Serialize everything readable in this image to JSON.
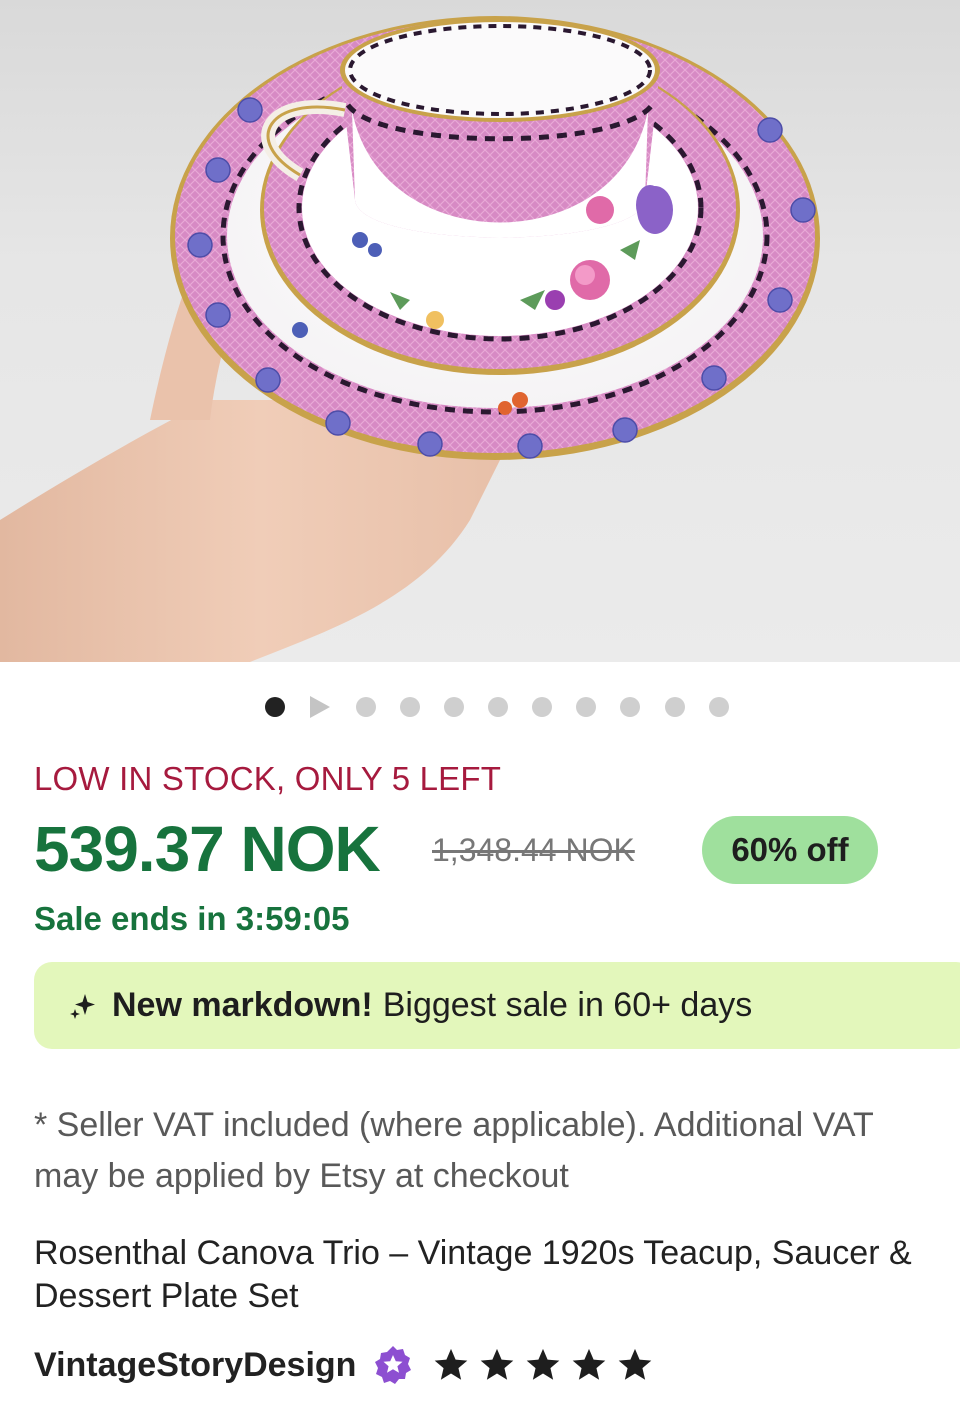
{
  "image": {
    "alt": "Hand holding floral teacup, saucer and plate",
    "carousel": {
      "total_dots": 10,
      "active_index": 0,
      "has_video_indicator": true
    }
  },
  "stock_notice": "LOW IN STOCK, ONLY 5 LEFT",
  "price": {
    "current": "539.37 NOK",
    "original": "1,348.44 NOK",
    "discount_badge": "60% off",
    "sale_ends": "Sale ends in 3:59:05"
  },
  "markdown_banner": {
    "icon": "sparkle-icon",
    "bold_text": "New markdown!",
    "text": "Biggest sale in 60+ days"
  },
  "vat_note": "* Seller VAT included (where applicable). Additional VAT may be applied by Etsy at checkout",
  "listing_title": "Rosenthal Canova Trio – Vintage 1920s Teacup, Saucer & Dessert Plate Set",
  "shop": {
    "name": "VintageStoryDesign",
    "star_seller_icon": "star-seller-badge-icon",
    "rating": 5,
    "rating_max": 5
  },
  "colors": {
    "price_green": "#17733d",
    "stock_red": "#a61a3e",
    "badge_green": "#9fe09d",
    "banner_bg": "#e3f7bb",
    "star_seller_purple": "#8d4fd1"
  }
}
